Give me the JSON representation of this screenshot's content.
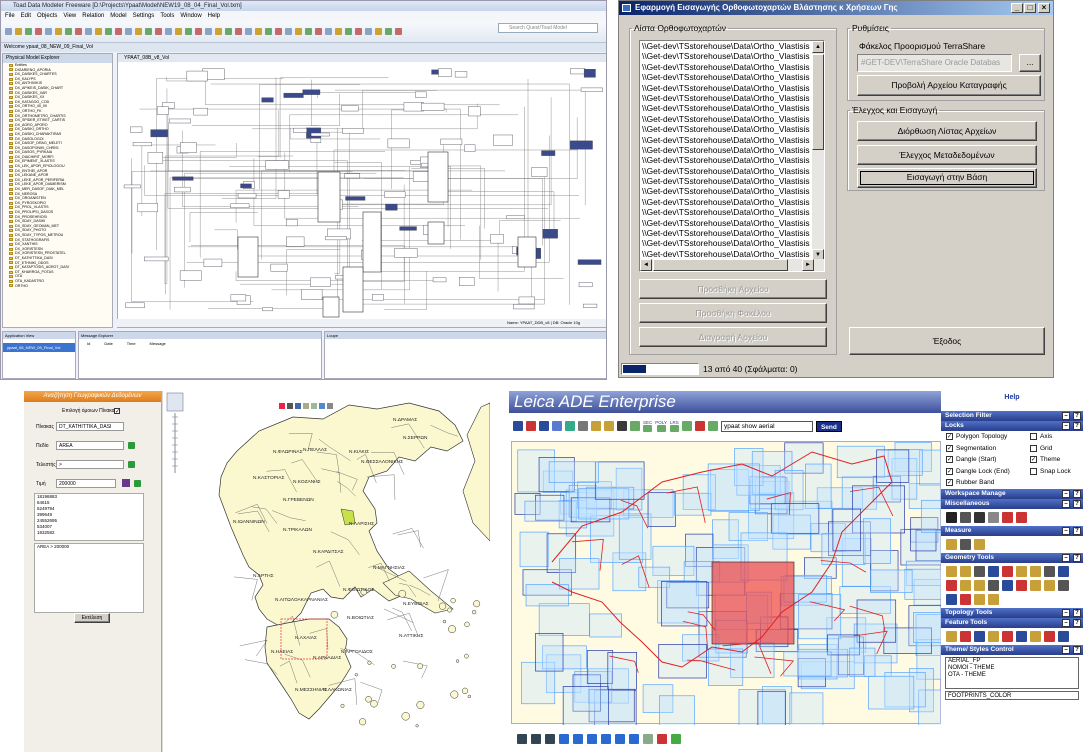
{
  "toad": {
    "title": "Toad Data Modeler Freeware [D:\\Projects\\Ypaat\\Model\\NEW19_08_04_Final_Vol.txm]",
    "menu": [
      "File",
      "Edit",
      "Objects",
      "View",
      "Relation",
      "Model",
      "Settings",
      "Tools",
      "Window",
      "Help"
    ],
    "search_placeholder": "Search Quest/Toad Model",
    "tabs": "Welcome  ypaat_08_NEW_09_Final_Vol",
    "left_header": "Physical Model Explorer",
    "tree": [
      "Entities",
      "DIGARIENO_APORIA",
      "DX_DASIKES_CHARTES",
      "DX_KALYPS",
      "DX_ANTHIVIKIS",
      "DX_APIKEIS_DASIK_CHART",
      "DX_DASIKES_XAR",
      "DX_DASIKES_XX",
      "DX_KATAGOG_COD",
      "DX_ORTHO_40_00",
      "DX_ORTHO_FK",
      "DX_ORTHOMETRO_CHARTIS",
      "DX_SPIDER_ETIKET_CARTIS",
      "DX_AGRO_APORO",
      "DX_DASIKI_ORTHO",
      "DX_DASIKI_CHARAKTIRAS",
      "DX_DASOLOGOI",
      "DX_DASOF_DRAG_MELETI",
      "DX_DASOPONIKI_CHRISI",
      "DX_DASOS_PYRKAIA",
      "DX_DIACHIRIT_MORFI",
      "DX_EPIMENT_XLASTIS",
      "DX_LEK_APOR_EPIOLOGOU",
      "DX_ENTHEI_APOR",
      "DX_LEKANE_APOR",
      "DX_LEKE_APOR_PERIFERIA",
      "DX_LEKE_APOR_DIAMERISM",
      "DX_MER_DASOF_DIAK_MEL",
      "DX_NEROSA",
      "DX_ORGANISTEN",
      "DX_PYROSKOPIO",
      "DX_PROL_VLASTIS",
      "DX_PROLIPSI_DASOS",
      "DX_PROSEHRIOSI",
      "DX_SDAY_DASIKI",
      "DX_SDAY_GEOMAN_MET",
      "DX_SDAY_PHOTO",
      "DX_SDAY_TYPOS_METROU",
      "DX_STATHOGRAFIS",
      "DX_XANTHIS",
      "DX_XORISTESN",
      "DX_XORISTESN_PROSTATEL",
      "DT_KATHITTIKA_DASI",
      "DT_ETHNIKI_ODOS",
      "DT_KATAPTOSIS_AGROT_DASI",
      "DT_KHARRGA_POTAS",
      "OTA",
      "OTA_KADASTRO",
      "ORTHO"
    ],
    "canvas_tab": "YPAAT_08B_v8_Vol",
    "status": "Name: YPAAT_DDB_v8 | DB: Oracle 10g",
    "bottom_left": "Application View",
    "bottom_left_item": "ypaat_08_NEW_09_Final_Vol",
    "bottom_mid": "Message Explorer",
    "bottom_mid_cols": [
      "Id",
      "Date",
      "Time",
      "Message"
    ],
    "bottom_right": "Loupe"
  },
  "dialog": {
    "title": "Εφαρμογή Εισαγωγής Ορθοφωτοχαρτών Βλάστησης κ Χρήσεων Γης",
    "list_legend": "Λίστα Ορθοφωτοχαρτών",
    "list_item": "\\\\Get-dev\\TSstorehouse\\Data\\Ortho_Vlastisis",
    "list_count": 24,
    "btn_add_file": "Προσθήκη Αρχείου",
    "btn_add_folder": "Προσθήκη Φακέλου",
    "btn_delete_file": "Διαγραφή Αρχείου",
    "settings_legend": "Ρυθμίσεις",
    "dest_label": "Φάκελος Προορισμού TerraShare",
    "dest_value": "#GET-DEV\\TerraShare Oracle Databas",
    "browse_btn": "...",
    "btn_view_log": "Προβολή Αρχείου Καταγραφής",
    "check_legend": "Έλεγχος και Εισαγωγή",
    "btn_fix_list": "Διόρθωση Λίστας Αρχείων",
    "btn_check_meta": "Έλεγχος Μεταδεδομένων",
    "btn_import": "Εισαγωγή στην Βάση",
    "btn_exit": "Έξοδος",
    "status_text": "13 από 40  (Σφάλματα: 0)",
    "progress": 0.325
  },
  "map": {
    "header": "Αναζήτηση Γεωγραφικών Δεδομένων",
    "select_all_label": "Επιλογή όμοιων Πίνακα",
    "table_label": "Πίνακας",
    "table_value": "DT_KATHITTIKA_DASI",
    "field_label": "Πεδίο",
    "field_value": "AREA",
    "operator_label": "Τελεστής",
    "operator_value": ">",
    "value_label": "Τιμή",
    "value_value": "200000",
    "results": [
      "18196883",
      "64615",
      "5249794",
      "399649",
      "24552695",
      "534007",
      "1832582"
    ],
    "query": "AREA > 200000",
    "run_btn": "Εκτέλεση",
    "labels": [
      {
        "t": "Ν.ΔΡΑΜΑΣ"
      },
      {
        "t": "Ν.ΣΕΡΡΩΝ"
      },
      {
        "t": "Ν.ΦΛΩΡΙΝΑΣ"
      },
      {
        "t": "Ν.ΠΕΛΛΑΣ"
      },
      {
        "t": "Ν.ΚΙΛΚΙΣ"
      },
      {
        "t": "Ν.ΘΕΣΣΑΛΟΝΙΚΗΣ"
      },
      {
        "t": "Ν.ΚΑΣΤΟΡΙΑΣ"
      },
      {
        "t": "Ν.ΚΟΖΑΝΗΣ"
      },
      {
        "t": "Ν.ΓΡΕΒΕΝΩΝ"
      },
      {
        "t": "Ν.ΙΩΑΝΝΙΝΩΝ"
      },
      {
        "t": "Ν.ΤΡΙΚΑΛΩΝ"
      },
      {
        "t": "Ν.ΛΑΡΙΣΗΣ"
      },
      {
        "t": "Ν.ΚΑΡΔΙΤΣΑΣ"
      },
      {
        "t": "Ν.ΑΡΤΗΣ"
      },
      {
        "t": "Ν.ΜΑΓΝΗΣΙΑΣ"
      },
      {
        "t": "Ν.ΑΙΤΩΛΟΑΚΑΡΝΑΝΙΑΣ"
      },
      {
        "t": "Ν.ΦΘΙΩΤΙΔΟΣ"
      },
      {
        "t": "Ν.ΕΥΒΟΙΑΣ"
      },
      {
        "t": "Ν.ΒΟΙΩΤΙΑΣ"
      },
      {
        "t": "Ν.ΑΧΑΙΑΣ"
      },
      {
        "t": "Ν.ΑΤΤΙΚΗΣ"
      },
      {
        "t": "Ν.ΗΛΕΙΑΣ"
      },
      {
        "t": "Ν.ΑΡΚΑΔΙΑΣ"
      },
      {
        "t": "Ν.ΑΡΓΟΛΙΔΟΣ"
      },
      {
        "t": "Ν.ΜΕΣΣΗΝΙΑΣ"
      },
      {
        "t": "Ν.ΛΑΚΩΝΙΑΣ"
      }
    ]
  },
  "leica": {
    "title": "Leica ADE Enterprise",
    "help": "Help",
    "command": "ypaat show aerial",
    "send": "Send",
    "sections": {
      "selection_filter": "Selection Filter",
      "locks": "Locks",
      "workspace": "Workspace Manage",
      "misc": "Miscellaneous",
      "measure": "Measure",
      "geometry": "Geometry Tools",
      "topology": "Topology Tools",
      "feature": "Feature Tools",
      "theme": "Theme/ Styles Control"
    },
    "locks_left": [
      {
        "label": "Polygon Topology",
        "checked": true
      },
      {
        "label": "Segmentation",
        "checked": true
      },
      {
        "label": "Dangle (Start)",
        "checked": true
      },
      {
        "label": "Dangle Lock (End)",
        "checked": true
      },
      {
        "label": "Rubber Band",
        "checked": true
      }
    ],
    "locks_right": [
      {
        "label": "Axis",
        "checked": false
      },
      {
        "label": "Grid",
        "checked": false
      },
      {
        "label": "Theme",
        "checked": true
      },
      {
        "label": "Snap Lock",
        "checked": false
      }
    ],
    "themes": [
      "AERIAL_FP",
      "NOMOI - THEME",
      "OTA - THEME"
    ],
    "footer_item": "FOOTPRINTS_COLOR",
    "tb_labels": [
      "SEC",
      "POLY",
      "LRS"
    ]
  },
  "colors": {
    "dialog_bg": "#d4d0c8",
    "leica_blue": "#2a3d8a",
    "map_land": "#fbf8cf",
    "footprint": "#5aa6ff",
    "boundary": "#ff2222"
  }
}
